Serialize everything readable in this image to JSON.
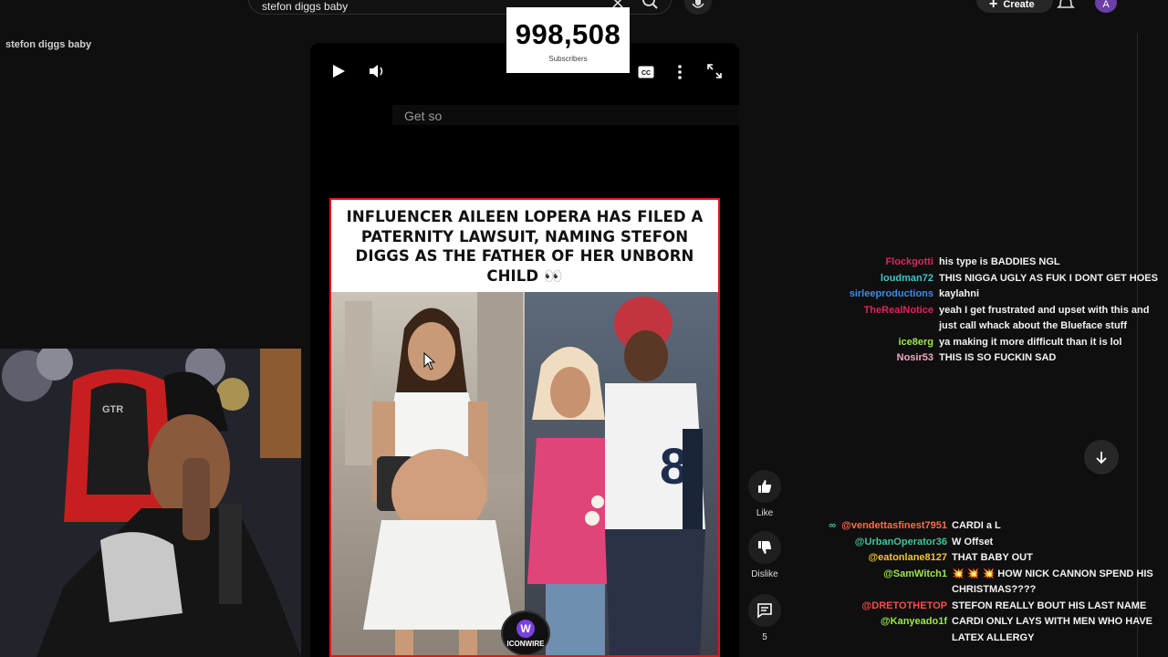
{
  "search": {
    "query": "stefon diggs baby",
    "create_label": "Create",
    "avatar_letter": "A"
  },
  "sidebar": {
    "tab_label": "stefon diggs baby"
  },
  "subscriber_overlay": {
    "count": "998,508",
    "label": "Subscribers"
  },
  "player": {
    "caption": "Get so"
  },
  "post": {
    "headline": "INFLUENCER AILEEN LOPERA HAS FILED A PATERNITY LAWSUIT, NAMING STEFON DIGGS AS THE FATHER OF HER UNBORN CHILD 👀",
    "brand": "ICONWIRE",
    "brand_letter": "W",
    "jersey_number": "8"
  },
  "actions": {
    "like_label": "Like",
    "dislike_label": "Dislike",
    "comments_count": "5"
  },
  "chat_upper": [
    {
      "user": "Flockgotti",
      "color": "#e0245e",
      "text": "his type is BADDIES NGL"
    },
    {
      "user": "loudman72",
      "color": "#3ec7c7",
      "text": "THIS NIGGA UGLY AS FUK I DONT GET HOES"
    },
    {
      "user": "sirleeproductions",
      "color": "#3b8ee8",
      "text": "kaylahni"
    },
    {
      "user": "TheRealNotice",
      "color": "#e0245e",
      "text": "yeah I get frustrated and upset with this and",
      "text2": "just call whack about the Blueface stuff"
    },
    {
      "user": "ice8erg",
      "color": "#9be84b",
      "text": "ya making it more difficult than it is lol"
    },
    {
      "user": "Nosir53",
      "color": "#f7a6c9",
      "text": "THIS IS SO FUCKIN SAD"
    }
  ],
  "chat_lower": [
    {
      "user": "@vendettasfinest7951",
      "color": "#ff6b4a",
      "text": "CARDI a L",
      "badge": "∞"
    },
    {
      "user": "@UrbanOperator36",
      "color": "#3ec79a",
      "text": "W Offset"
    },
    {
      "user": "@eatonlane8127",
      "color": "#f2c33a",
      "text": "THAT BABY OUT"
    },
    {
      "user": "@SamWitch1",
      "color": "#9be84b",
      "text": "💥 💥 💥 HOW NICK CANNON SPEND HIS",
      "text2": "CHRISTMAS????"
    },
    {
      "user": "@DRETOTHETOP",
      "color": "#ff4a4a",
      "text": "STEFON REALLY BOUT HIS LAST NAME"
    },
    {
      "user": "@Kanyeado1f",
      "color": "#9be84b",
      "text": "CARDI ONLY LAYS WITH MEN WHO HAVE",
      "text2": "LATEX ALLERGY"
    }
  ]
}
